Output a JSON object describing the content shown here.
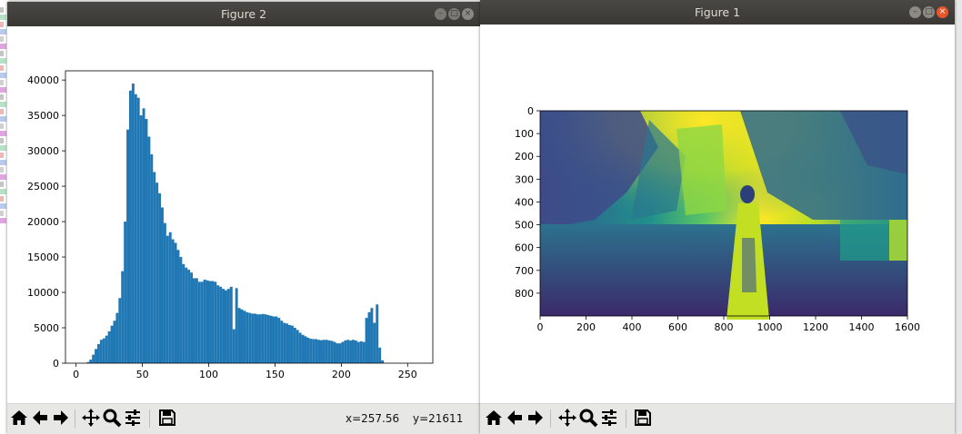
{
  "figure2": {
    "title": "Figure 2",
    "status_x": "x=257.56",
    "status_y": "y=21611",
    "chart_data": {
      "type": "bar",
      "x_ticks": [
        "0",
        "50",
        "100",
        "150",
        "200",
        "250"
      ],
      "y_ticks": [
        "0",
        "5000",
        "10000",
        "15000",
        "20000",
        "25000",
        "30000",
        "35000",
        "40000"
      ],
      "xlim": [
        -8,
        269
      ],
      "ylim": [
        0,
        41300
      ],
      "bin_width": 2,
      "bins_start": [
        8,
        10,
        12,
        14,
        16,
        18,
        20,
        22,
        24,
        26,
        28,
        30,
        32,
        34,
        36,
        38,
        40,
        42,
        44,
        46,
        48,
        50,
        52,
        54,
        56,
        58,
        60,
        62,
        64,
        66,
        68,
        70,
        72,
        74,
        76,
        78,
        80,
        82,
        84,
        86,
        88,
        90,
        92,
        94,
        96,
        98,
        100,
        102,
        104,
        106,
        108,
        110,
        112,
        114,
        116,
        118,
        120,
        122,
        124,
        126,
        128,
        130,
        132,
        134,
        136,
        138,
        140,
        142,
        144,
        146,
        148,
        150,
        152,
        154,
        156,
        158,
        160,
        162,
        164,
        166,
        168,
        170,
        172,
        174,
        176,
        178,
        180,
        182,
        184,
        186,
        188,
        190,
        192,
        194,
        196,
        198,
        200,
        202,
        204,
        206,
        208,
        210,
        212,
        214,
        216,
        218,
        220,
        222,
        224,
        226,
        228,
        230,
        232,
        234,
        236,
        238,
        240,
        242,
        244,
        246,
        248,
        250,
        252,
        254
      ],
      "values": [
        150,
        500,
        1200,
        2000,
        2700,
        3300,
        3500,
        3900,
        4500,
        5300,
        6000,
        7100,
        9200,
        13000,
        20000,
        33000,
        38500,
        39500,
        38000,
        37500,
        35000,
        36000,
        34500,
        32000,
        29500,
        27000,
        25500,
        24000,
        22000,
        19800,
        18000,
        18500,
        17500,
        17000,
        16000,
        15000,
        14000,
        13500,
        13200,
        12800,
        12000,
        12000,
        11500,
        11500,
        11800,
        11700,
        11600,
        11600,
        11500,
        11000,
        10800,
        10500,
        10300,
        10500,
        10800,
        4800,
        10600,
        7800,
        7600,
        7400,
        7200,
        7100,
        7000,
        7000,
        6900,
        6900,
        6950,
        6900,
        6800,
        6700,
        6600,
        6600,
        6400,
        6000,
        5700,
        5600,
        5400,
        5300,
        5000,
        4700,
        4300,
        4000,
        3800,
        3600,
        3450,
        3400,
        3400,
        3300,
        3250,
        3300,
        3300,
        3200,
        3150,
        3000,
        2800,
        2800,
        3000,
        3200,
        3300,
        3200,
        3300,
        3200,
        3000,
        3100,
        3000,
        6400,
        7200,
        7800,
        5700,
        8300,
        2200,
        400
      ]
    },
    "toolbar": [
      "home-icon",
      "back-icon",
      "forward-icon",
      "pan-icon",
      "zoom-icon",
      "configure-icon",
      "save-icon"
    ]
  },
  "figure1": {
    "title": "Figure 1",
    "chart_data": {
      "type": "heatmap",
      "x_ticks": [
        "0",
        "200",
        "400",
        "600",
        "800",
        "1000",
        "1200",
        "1400",
        "1600"
      ],
      "y_ticks": [
        "0",
        "100",
        "200",
        "300",
        "400",
        "500",
        "600",
        "700",
        "800"
      ],
      "xlim": [
        0,
        1600
      ],
      "ylim": [
        0,
        900
      ]
    },
    "toolbar": [
      "home-icon",
      "back-icon",
      "forward-icon",
      "pan-icon",
      "zoom-icon",
      "configure-icon",
      "save-icon"
    ]
  },
  "colors": {
    "bar": "#1f77b4",
    "titlebar": "#3c3b37",
    "close": "#e8572c"
  }
}
